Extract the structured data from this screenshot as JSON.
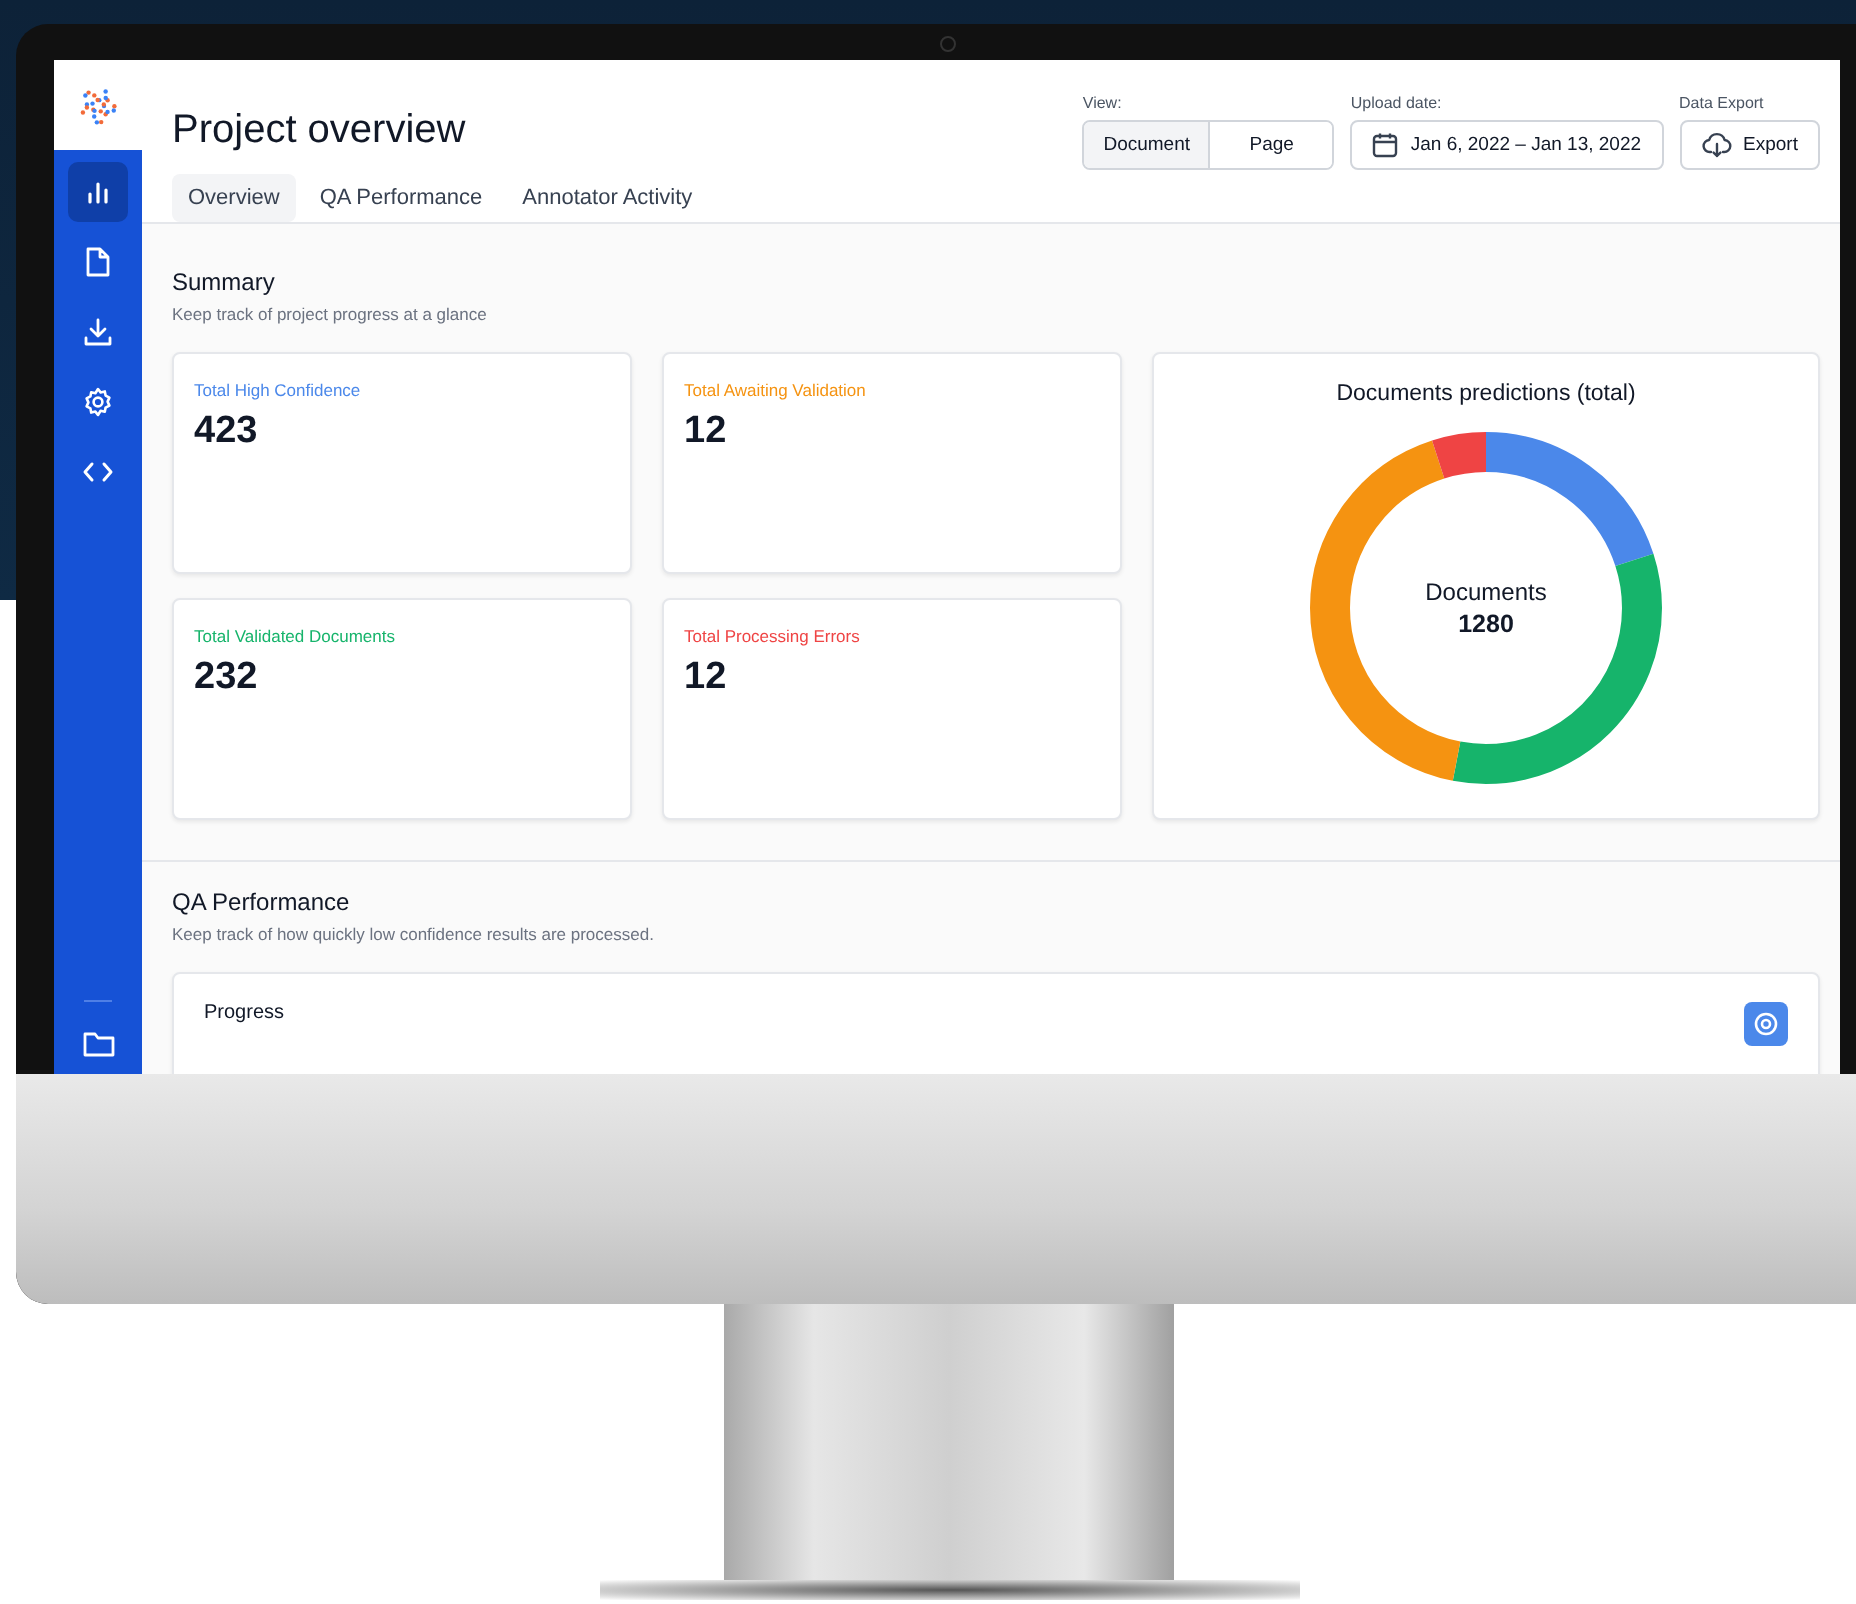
{
  "sidebar": {
    "items": [
      {
        "kind": "chart",
        "selected": true
      },
      {
        "kind": "file",
        "selected": false
      },
      {
        "kind": "download",
        "selected": false
      },
      {
        "kind": "settings",
        "selected": false
      },
      {
        "kind": "code",
        "selected": false
      }
    ],
    "bottom_items": [
      {
        "kind": "folder",
        "selected": false
      }
    ]
  },
  "header": {
    "title": "Project overview",
    "tabs": [
      {
        "label": "Overview",
        "selected": true
      },
      {
        "label": "QA Performance",
        "selected": false
      },
      {
        "label": "Annotator Activity",
        "selected": false
      }
    ],
    "view": {
      "label": "View:",
      "options": [
        {
          "label": "Document",
          "selected": true
        },
        {
          "label": "Page",
          "selected": false
        }
      ]
    },
    "upload_date": {
      "label": "Upload date:",
      "value": "Jan 6, 2022 – Jan 13, 2022"
    },
    "data_export": {
      "label": "Data Export",
      "button": "Export"
    }
  },
  "summary": {
    "title": "Summary",
    "subtitle": "Keep track of project progress at a glance",
    "stats": [
      {
        "label": "Total High Confidence",
        "value": "423",
        "color": "#4b88ea"
      },
      {
        "label": "Total Awaiting Validation",
        "value": "12",
        "color": "#f59311"
      },
      {
        "label": "Total Validated Documents",
        "value": "232",
        "color": "#16b46b"
      },
      {
        "label": "Total Processing Errors",
        "value": "12",
        "color": "#ef4444"
      }
    ],
    "donut": {
      "title": "Documents predictions (total)",
      "center_label": "Documents",
      "center_value": "1280"
    }
  },
  "qa_performance": {
    "title": "QA Performance",
    "subtitle": "Keep track of how quickly low confidence results are processed.",
    "card_title": "Progress"
  }
}
